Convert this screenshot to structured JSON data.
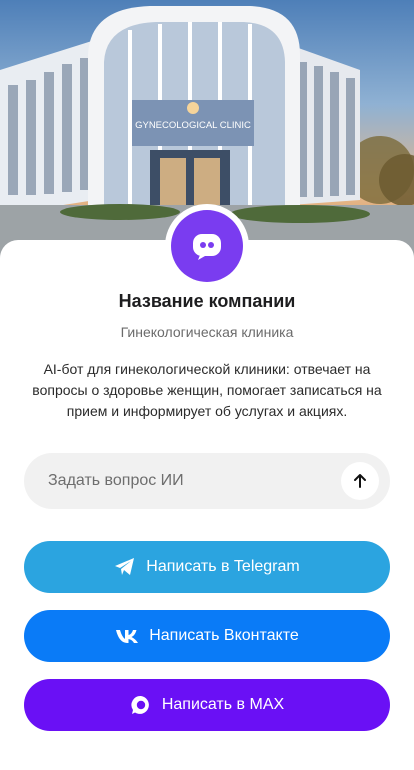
{
  "hero": {
    "sign_text": "GYNECOLOGICAL CLINIC"
  },
  "profile": {
    "avatar_icon": "chat-bot-icon",
    "company_name": "Название компании",
    "category": "Гинекологическая клиника",
    "description": "AI-бот для гинекологической клиники: отвечает на вопросы о здоровье женщин, помогает записаться на прием и информирует об услугах и акциях."
  },
  "ask": {
    "placeholder": "Задать вопрос ИИ",
    "send_icon": "arrow-up-icon"
  },
  "buttons": {
    "telegram": {
      "label": "Написать в Telegram",
      "icon": "telegram-icon",
      "color": "#2ba4e0"
    },
    "vk": {
      "label": "Написать Вконтакте",
      "icon": "vk-icon",
      "color": "#0a7bf7"
    },
    "max": {
      "label": "Написать в MAX",
      "icon": "max-icon",
      "color": "#6a10f5"
    }
  },
  "colors": {
    "avatar": "#7a3cf0"
  }
}
